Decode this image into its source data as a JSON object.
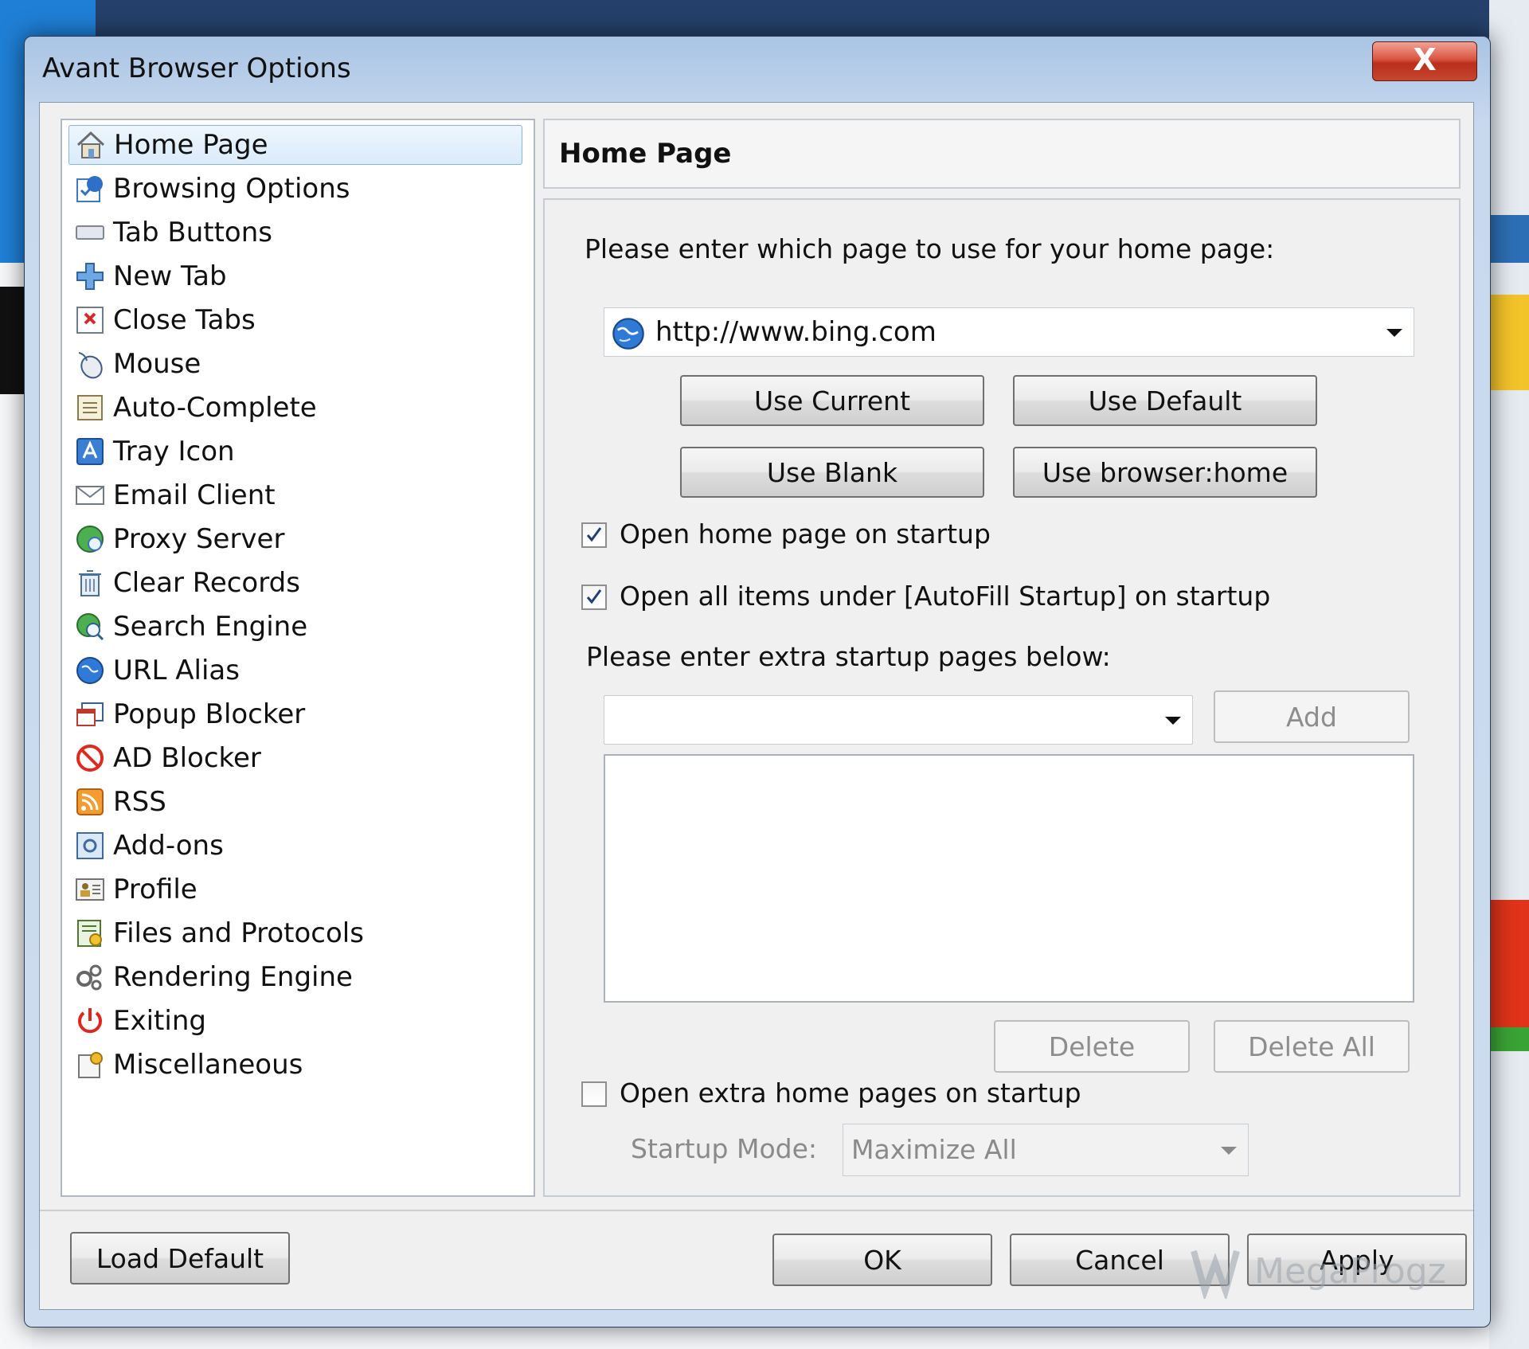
{
  "window": {
    "title": "Avant Browser Options",
    "close_label": "X"
  },
  "nav": {
    "items": [
      {
        "label": "Home Page",
        "icon": "home-icon",
        "selected": true
      },
      {
        "label": "Browsing Options",
        "icon": "browsing-options-icon"
      },
      {
        "label": "Tab Buttons",
        "icon": "tab-buttons-icon"
      },
      {
        "label": "New Tab",
        "icon": "plus-icon"
      },
      {
        "label": "Close Tabs",
        "icon": "close-tabs-icon"
      },
      {
        "label": "Mouse",
        "icon": "mouse-icon"
      },
      {
        "label": "Auto-Complete",
        "icon": "auto-complete-icon"
      },
      {
        "label": "Tray Icon",
        "icon": "tray-icon"
      },
      {
        "label": "Email Client",
        "icon": "email-icon"
      },
      {
        "label": "Proxy Server",
        "icon": "proxy-globe-icon"
      },
      {
        "label": "Clear Records",
        "icon": "trash-icon"
      },
      {
        "label": "Search Engine",
        "icon": "search-globe-icon"
      },
      {
        "label": "URL Alias",
        "icon": "globe-icon"
      },
      {
        "label": "Popup Blocker",
        "icon": "popup-blocker-icon"
      },
      {
        "label": "AD Blocker",
        "icon": "no-entry-icon"
      },
      {
        "label": "RSS",
        "icon": "rss-icon"
      },
      {
        "label": "Add-ons",
        "icon": "addons-icon"
      },
      {
        "label": "Profile",
        "icon": "profile-icon"
      },
      {
        "label": "Files and Protocols",
        "icon": "files-icon"
      },
      {
        "label": "Rendering Engine",
        "icon": "gears-icon"
      },
      {
        "label": "Exiting",
        "icon": "power-icon"
      },
      {
        "label": "Miscellaneous",
        "icon": "misc-icon"
      }
    ]
  },
  "panel": {
    "title": "Home Page",
    "prompt": "Please enter which page to use for your home page:",
    "home_url": "http://www.bing.com",
    "buttons": {
      "use_current": "Use Current",
      "use_default": "Use Default",
      "use_blank": "Use Blank",
      "use_browser_home": "Use browser:home"
    },
    "open_home_on_startup": {
      "label": "Open home page on startup",
      "checked": true
    },
    "open_autofill_on_startup": {
      "label": "Open all items under [AutoFill Startup] on startup",
      "checked": true
    },
    "extra_prompt": "Please enter extra startup pages below:",
    "extra_url": "",
    "add_label": "Add",
    "delete_label": "Delete",
    "delete_all_label": "Delete All",
    "open_extra_on_startup": {
      "label": "Open extra home pages on startup",
      "checked": false
    },
    "startup_mode_label": "Startup Mode:",
    "startup_mode_value": "Maximize All"
  },
  "footer": {
    "load_default": "Load Default",
    "ok": "OK",
    "cancel": "Cancel",
    "apply": "Apply"
  },
  "watermark": {
    "text": "MegaProgz"
  },
  "colors": {
    "selected_bg": "#d9ebfb",
    "close_red": "#c7452e",
    "dialog_frame": "#c8d9ee"
  }
}
